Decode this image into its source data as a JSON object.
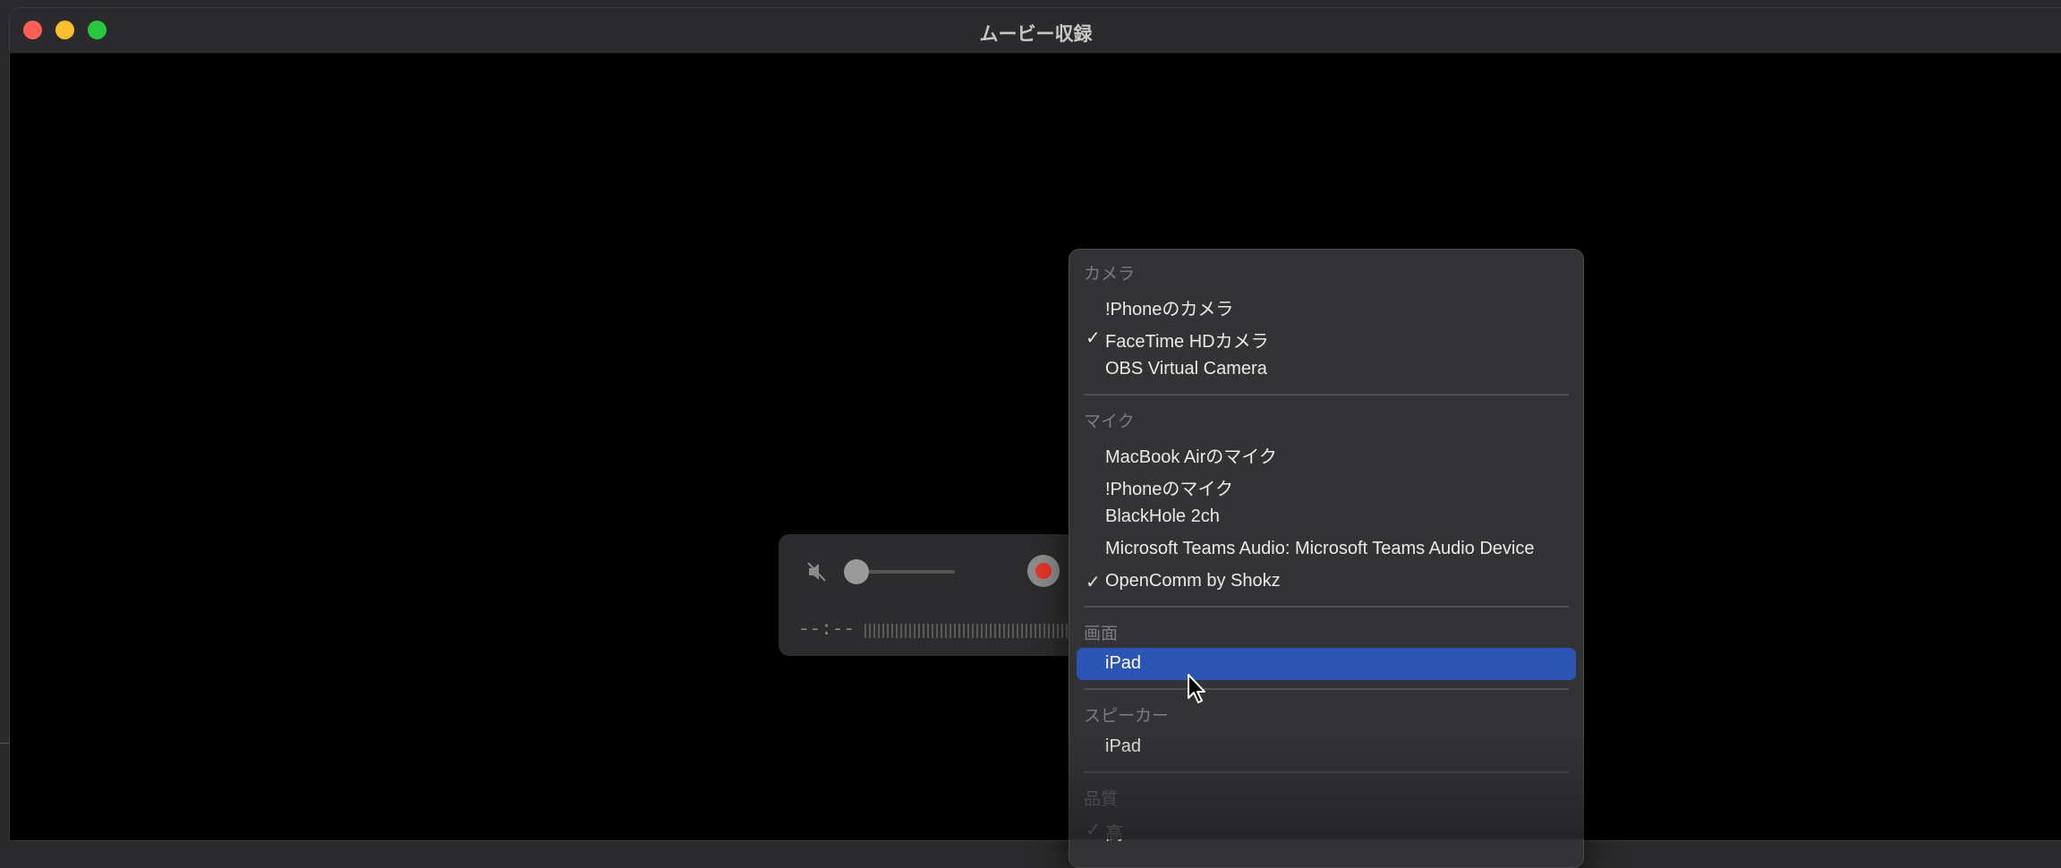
{
  "window": {
    "title": "ムービー収録"
  },
  "controller": {
    "timecode": "--:--",
    "volume_level": 0.1
  },
  "menu": {
    "camera": {
      "header": "カメラ",
      "items": [
        {
          "label": "!Phoneのカメラ",
          "checked": ""
        },
        {
          "label": "FaceTime HDカメラ",
          "checked": "✓"
        },
        {
          "label": "OBS Virtual Camera",
          "checked": ""
        }
      ]
    },
    "mic": {
      "header": "マイク",
      "items": [
        {
          "label": "MacBook Airのマイク",
          "checked": ""
        },
        {
          "label": "!Phoneのマイク",
          "checked": ""
        },
        {
          "label": "BlackHole 2ch",
          "checked": ""
        },
        {
          "label": "Microsoft Teams Audio: Microsoft Teams Audio Device",
          "checked": ""
        },
        {
          "label": "OpenComm by Shokz",
          "checked": "✓"
        }
      ]
    },
    "screen": {
      "header": "画面",
      "items": [
        {
          "label": "iPad",
          "checked": ""
        }
      ]
    },
    "speaker": {
      "header": "スピーカー",
      "items": [
        {
          "label": "iPad",
          "checked": ""
        }
      ]
    },
    "quality": {
      "header": "品質",
      "items": [
        {
          "label": "高",
          "checked": "✓"
        }
      ]
    }
  },
  "colors": {
    "highlight": "#2b55b5",
    "record": "#e5352b",
    "close": "#ff5f57",
    "minimize": "#febc2e",
    "maximize": "#28c840"
  }
}
